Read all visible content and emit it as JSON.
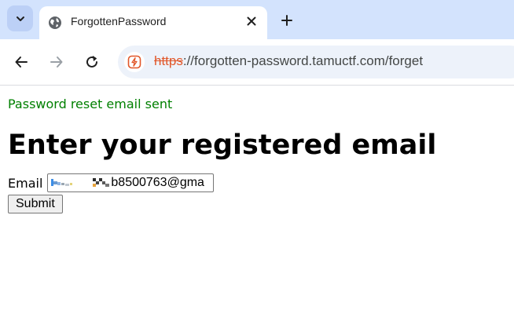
{
  "browser": {
    "tab": {
      "title": "ForgottenPassword"
    },
    "address": {
      "scheme": "https",
      "rest": "://forgotten-password.tamuctf.com/forget"
    },
    "icons": {
      "tab_search": "chevron-down-icon",
      "tab_favicon": "globe-icon",
      "tab_close": "close-icon",
      "new_tab": "plus-icon",
      "back": "arrow-left-icon",
      "forward": "arrow-right-icon",
      "reload": "reload-icon",
      "site_info": "not-secure-icon"
    }
  },
  "page": {
    "status_message": "Password reset email sent",
    "heading": "Enter your registered email",
    "form": {
      "email_label": "Email",
      "email_value_visible": "b8500763@gma",
      "submit_label": "Submit"
    }
  },
  "colors": {
    "status": "#008000",
    "tabbar": "#d3e3fd",
    "omnibox": "#edf2fa",
    "insecure_scheme": "#e1572a"
  }
}
